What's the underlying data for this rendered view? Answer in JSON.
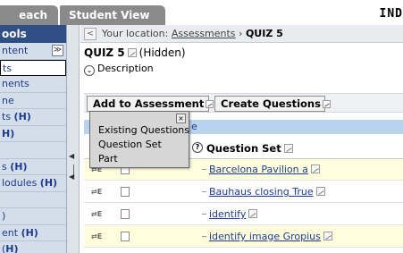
{
  "tabs": {
    "teach": "each",
    "student_view": "Student View",
    "header_right": "IND"
  },
  "sidebar": {
    "header": "ools",
    "items": [
      {
        "label": "ntent",
        "h": ""
      },
      {
        "label": "ts",
        "h": ""
      },
      {
        "label": "nents",
        "h": ""
      },
      {
        "label": "ne",
        "h": ""
      },
      {
        "label": "ts ",
        "h": "(H)"
      },
      {
        "label": "",
        "h": "H)"
      },
      {
        "label": "",
        "h": ""
      },
      {
        "label": "s ",
        "h": "(H)"
      },
      {
        "label": "lodules ",
        "h": "(H)"
      },
      {
        "label": "",
        "h": ""
      },
      {
        "label": ")",
        "h": ""
      },
      {
        "label": "ent ",
        "h": "(H)"
      },
      {
        "label": "(",
        "h": "H)"
      }
    ]
  },
  "breadcrumb": {
    "prefix": "Your location: ",
    "link": "Assessments",
    "separator": " › ",
    "current": "QUIZ 5"
  },
  "quiz": {
    "title": "QUIZ 5",
    "status": "(Hidden)",
    "description_label": "Description"
  },
  "toolbar": {
    "add_label": "Add to Assessment",
    "create_label": "Create Questions"
  },
  "strip_text": "e",
  "table": {
    "header_help": "?",
    "header_question_set": "Question Set",
    "rows": [
      {
        "title": "Barcelona Pavilion a"
      },
      {
        "title": "Bauhaus closing True"
      },
      {
        "title": "identify"
      },
      {
        "title": "identify image Gropius"
      }
    ]
  },
  "popup": {
    "items": [
      "Existing Questions",
      "Question Set",
      "Part"
    ]
  }
}
